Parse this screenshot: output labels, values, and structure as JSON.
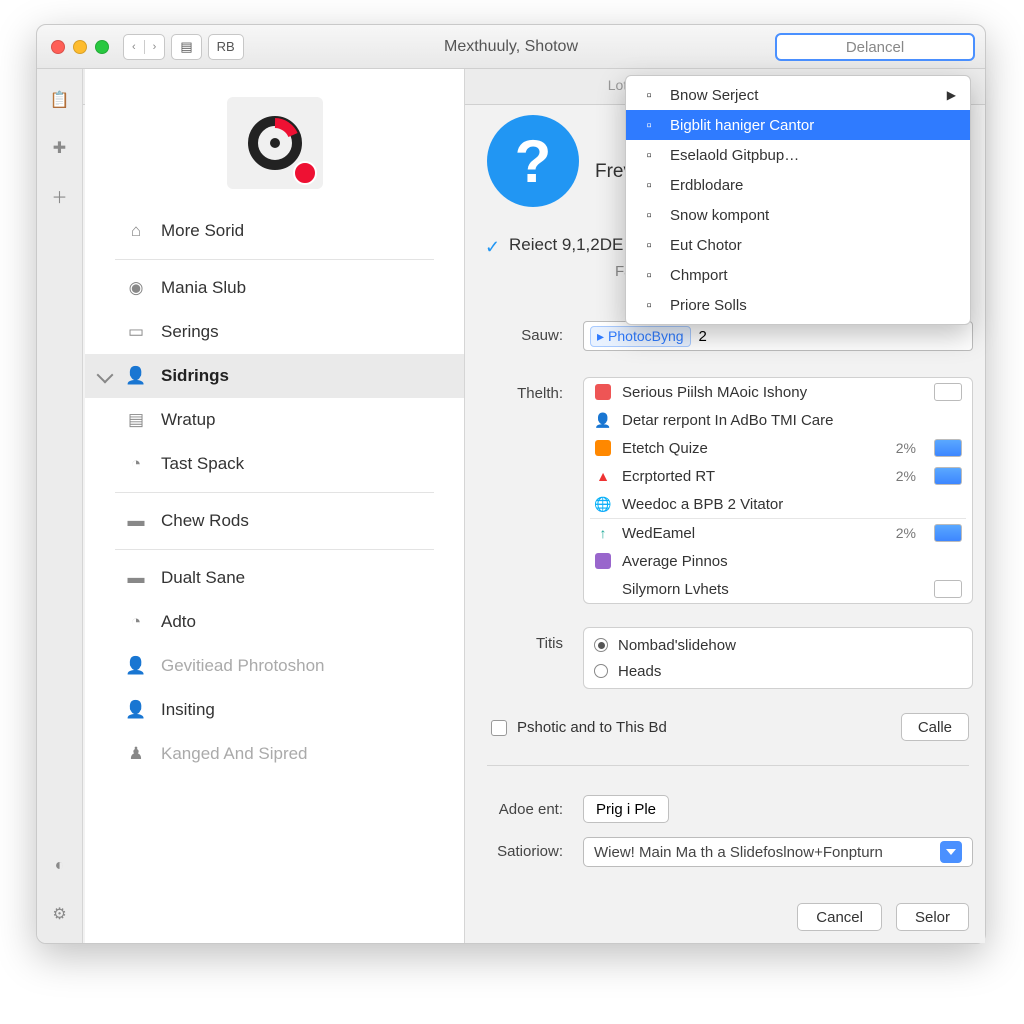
{
  "titlebar": {
    "toolbar_rb": "RB",
    "title": "Mexthuuly, Shotow",
    "top_button": "Delancel",
    "secondary_label": "Lote"
  },
  "sidebar": {
    "items": [
      {
        "label": "More Sorid",
        "icon": "home-icon"
      },
      {
        "label": "Mania Slub",
        "icon": "camera-icon"
      },
      {
        "label": "Serings",
        "icon": "tag-icon"
      },
      {
        "label": "Sidrings",
        "icon": "person-icon",
        "selected": true
      },
      {
        "label": "Wratup",
        "icon": "note-icon"
      },
      {
        "label": "Tast Spack",
        "icon": "clock-icon"
      },
      {
        "label": "Chew Rods",
        "icon": "folder-icon"
      },
      {
        "label": "Dualt Sane",
        "icon": "folder-icon"
      },
      {
        "label": "Adto",
        "icon": "clock-icon"
      },
      {
        "label": "Gevitiead Phrotoshon",
        "icon": "person-icon",
        "dim": true
      },
      {
        "label": "Insiting",
        "icon": "person-icon"
      },
      {
        "label": "Kanged And Sipred",
        "icon": "monument-icon",
        "dim": true
      }
    ]
  },
  "dropdown": {
    "items": [
      {
        "label": "Bnow Serject",
        "has_submenu": true
      },
      {
        "label": "Bigblit haniger Cantor",
        "highlight": true
      },
      {
        "label": "Eselaold Gitpbup…"
      },
      {
        "label": "Erdblodare"
      },
      {
        "label": "Snow kompont"
      },
      {
        "label": "Eut Chotor"
      },
      {
        "label": "Chmport"
      },
      {
        "label": "Priore Solls"
      }
    ]
  },
  "main": {
    "frev": "Frev",
    "checked_label": "Reiect 9,1,2DE",
    "fa": "Fa",
    "sauw_label": "Sauw:",
    "sauw_pill": "PhotocByng",
    "sauw_value": "2",
    "thelth_label": "Thelth:",
    "list": [
      {
        "label": "Serious Piilsh MAoic Ishony",
        "icon": "red-sq",
        "ctrl": "stepper"
      },
      {
        "label": "Detar rerpont In AdBo TMI Care",
        "icon": "blue-person"
      },
      {
        "label": "Etetch Quize",
        "icon": "orange-sq",
        "pct": "2%",
        "ctrl": "blue"
      },
      {
        "label": "Ecrptorted RT",
        "icon": "warn",
        "pct": "2%",
        "ctrl": "blue"
      },
      {
        "label": "Weedoc a BPB 2 Vitator",
        "icon": "chrome"
      },
      {
        "label": "WedEamel",
        "icon": "up-arrow",
        "pct": "2%",
        "ctrl": "blue",
        "sep_before": true
      },
      {
        "label": "Average Pinnos",
        "icon": "violet-sq"
      },
      {
        "label": "Silymorn Lvhets",
        "ctrl": "stepper"
      }
    ],
    "titis_label": "Titis",
    "radios": [
      {
        "label": "Nombad'slidehow",
        "on": true
      },
      {
        "label": "Heads"
      }
    ],
    "checkbox_label": "Pshotic and to This Bd",
    "calle": "Calle",
    "adoe_label": "Adoe ent:",
    "adoe_button": "Prig i Ple",
    "sationow_label": "Satioriow:",
    "sationow_value": "Wiew! Main Ma th a Slidefoslnow+Fonpturn",
    "cancel": "Cancel",
    "selor": "Selor"
  }
}
